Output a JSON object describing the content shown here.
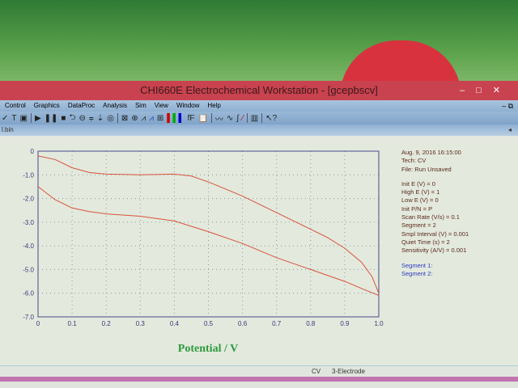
{
  "window": {
    "title": "CHI660E Electrochemical Workstation - [gcepbscv]"
  },
  "menu": [
    "Control",
    "Graphics",
    "DataProc",
    "Analysis",
    "Sim",
    "View",
    "Window",
    "Help"
  ],
  "toolbar_icons": [
    "system-icon",
    "text-icon",
    "text-box-icon",
    "run-icon",
    "pause-icon",
    "stop-icon",
    "reverse-icon",
    "stir-icon",
    "ir-comp-icon",
    "filter-icon",
    "cell-icon",
    "graph-icon",
    "zoom-icon",
    "peak-icon",
    "overlay-icon",
    "add-data-icon",
    "color-icon",
    "font-icon",
    "clipboard-icon",
    "smooth-icon",
    "derivative-icon",
    "integrate-icon",
    "interpolate-icon",
    "grid-icon",
    "help-pointer-icon"
  ],
  "file_tab": "l.bin",
  "info": {
    "date": "Aug. 9, 2016   16:15:00",
    "tech": "Tech: CV",
    "file": "File: Run Unsaved",
    "params": [
      "Init E (V) = 0",
      "High E (V) = 1",
      "Low E (V) = 0",
      "Init P/N = P",
      "Scan Rate (V/s) = 0.1",
      "Segment = 2",
      "Smpl Interval (V) = 0.001",
      "Quiet Time (s) = 2",
      "Sensitivity (A/V) = 0.001"
    ],
    "segments": [
      "Segment 1:",
      "Segment 2:"
    ]
  },
  "status": {
    "tech": "CV",
    "mode": "3-Electrode"
  },
  "chart_data": {
    "type": "line",
    "title": "",
    "xlabel": "Potential / V",
    "ylabel": "",
    "xlim": [
      0,
      1.0
    ],
    "ylim": [
      -7.0,
      0
    ],
    "xticks": [
      "0",
      "0.1",
      "0.2",
      "0.3",
      "0.4",
      "0.5",
      "0.6",
      "0.7",
      "0.8",
      "0.9",
      "1.0"
    ],
    "yticks": [
      "0",
      "-1.0",
      "-2.0",
      "-3.0",
      "-4.0",
      "-5.0",
      "-6.0",
      "-7.0"
    ],
    "grid": true,
    "line_color": "#d9533c",
    "series": [
      {
        "name": "Segment 1",
        "x": [
          0,
          0.05,
          0.1,
          0.15,
          0.2,
          0.3,
          0.4,
          0.45,
          0.5,
          0.6,
          0.7,
          0.8,
          0.85,
          0.9,
          0.95,
          0.98,
          1.0
        ],
        "y": [
          -0.2,
          -0.35,
          -0.7,
          -0.9,
          -0.97,
          -1.0,
          -0.97,
          -1.05,
          -1.3,
          -1.9,
          -2.6,
          -3.3,
          -3.65,
          -4.1,
          -4.7,
          -5.3,
          -6.0
        ]
      },
      {
        "name": "Segment 2",
        "x": [
          0,
          0.05,
          0.1,
          0.15,
          0.2,
          0.3,
          0.4,
          0.5,
          0.6,
          0.7,
          0.8,
          0.9,
          0.95,
          1.0
        ],
        "y": [
          -1.5,
          -2.05,
          -2.4,
          -2.55,
          -2.65,
          -2.75,
          -2.95,
          -3.4,
          -3.9,
          -4.5,
          -5.0,
          -5.5,
          -5.8,
          -6.1
        ]
      }
    ]
  }
}
